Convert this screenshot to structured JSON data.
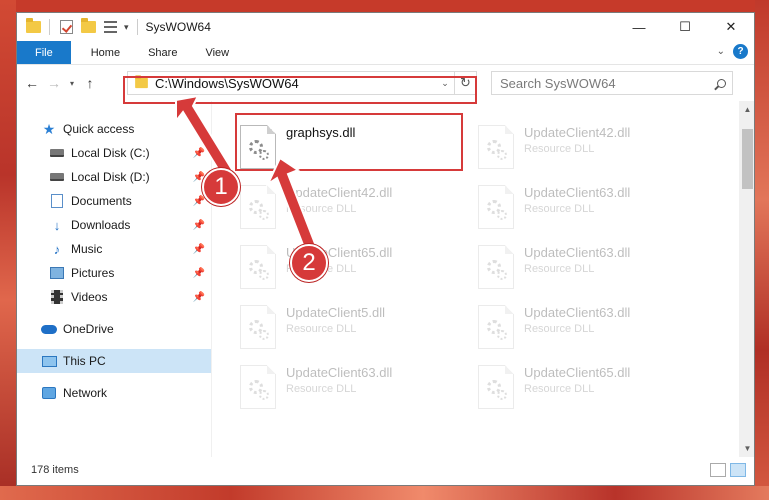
{
  "window": {
    "title": "SysWOW64",
    "minimize": "—",
    "maximize": "☐",
    "close": "✕"
  },
  "ribbon": {
    "tabs": [
      "File",
      "Home",
      "Share",
      "View"
    ],
    "help": "?"
  },
  "address": {
    "path": "C:\\Windows\\SysWOW64",
    "search_placeholder": "Search SysWOW64"
  },
  "nav_pane": {
    "items": [
      {
        "label": "Quick access",
        "icon": "star-icon"
      },
      {
        "label": "Local Disk (C:)",
        "icon": "drive-icon",
        "pinned": true
      },
      {
        "label": "Local Disk (D:)",
        "icon": "drive-icon",
        "pinned": true
      },
      {
        "label": "Documents",
        "icon": "documents-icon",
        "pinned": true
      },
      {
        "label": "Downloads",
        "icon": "downloads-icon",
        "pinned": true
      },
      {
        "label": "Music",
        "icon": "music-icon",
        "pinned": true
      },
      {
        "label": "Pictures",
        "icon": "pictures-icon",
        "pinned": true
      },
      {
        "label": "Videos",
        "icon": "videos-icon",
        "pinned": true
      },
      {
        "label": "OneDrive",
        "icon": "onedrive-icon"
      },
      {
        "label": "This PC",
        "icon": "this-pc-icon",
        "selected": true
      },
      {
        "label": "Network",
        "icon": "network-icon"
      }
    ]
  },
  "files": [
    {
      "name": "graphsys.dll",
      "type": ""
    },
    {
      "name": "UpdateClient42.dll",
      "type": "Resource DLL"
    },
    {
      "name": "UpdateClient42.dll",
      "type": "Resource DLL"
    },
    {
      "name": "UpdateClient63.dll",
      "type": "Resource DLL"
    },
    {
      "name": "UpdateClient65.dll",
      "type": "Resource DLL"
    },
    {
      "name": "UpdateClient63.dll",
      "type": "Resource DLL"
    },
    {
      "name": "UpdateClient5.dll",
      "type": "Resource DLL"
    },
    {
      "name": "UpdateClient63.dll",
      "type": "Resource DLL"
    },
    {
      "name": "UpdateClient63.dll",
      "type": "Resource DLL"
    },
    {
      "name": "UpdateClient65.dll",
      "type": "Resource DLL"
    }
  ],
  "status": {
    "item_count": "178 items"
  },
  "annotations": {
    "marker_1": "1",
    "marker_2": "2",
    "color": "#d63a3a"
  }
}
